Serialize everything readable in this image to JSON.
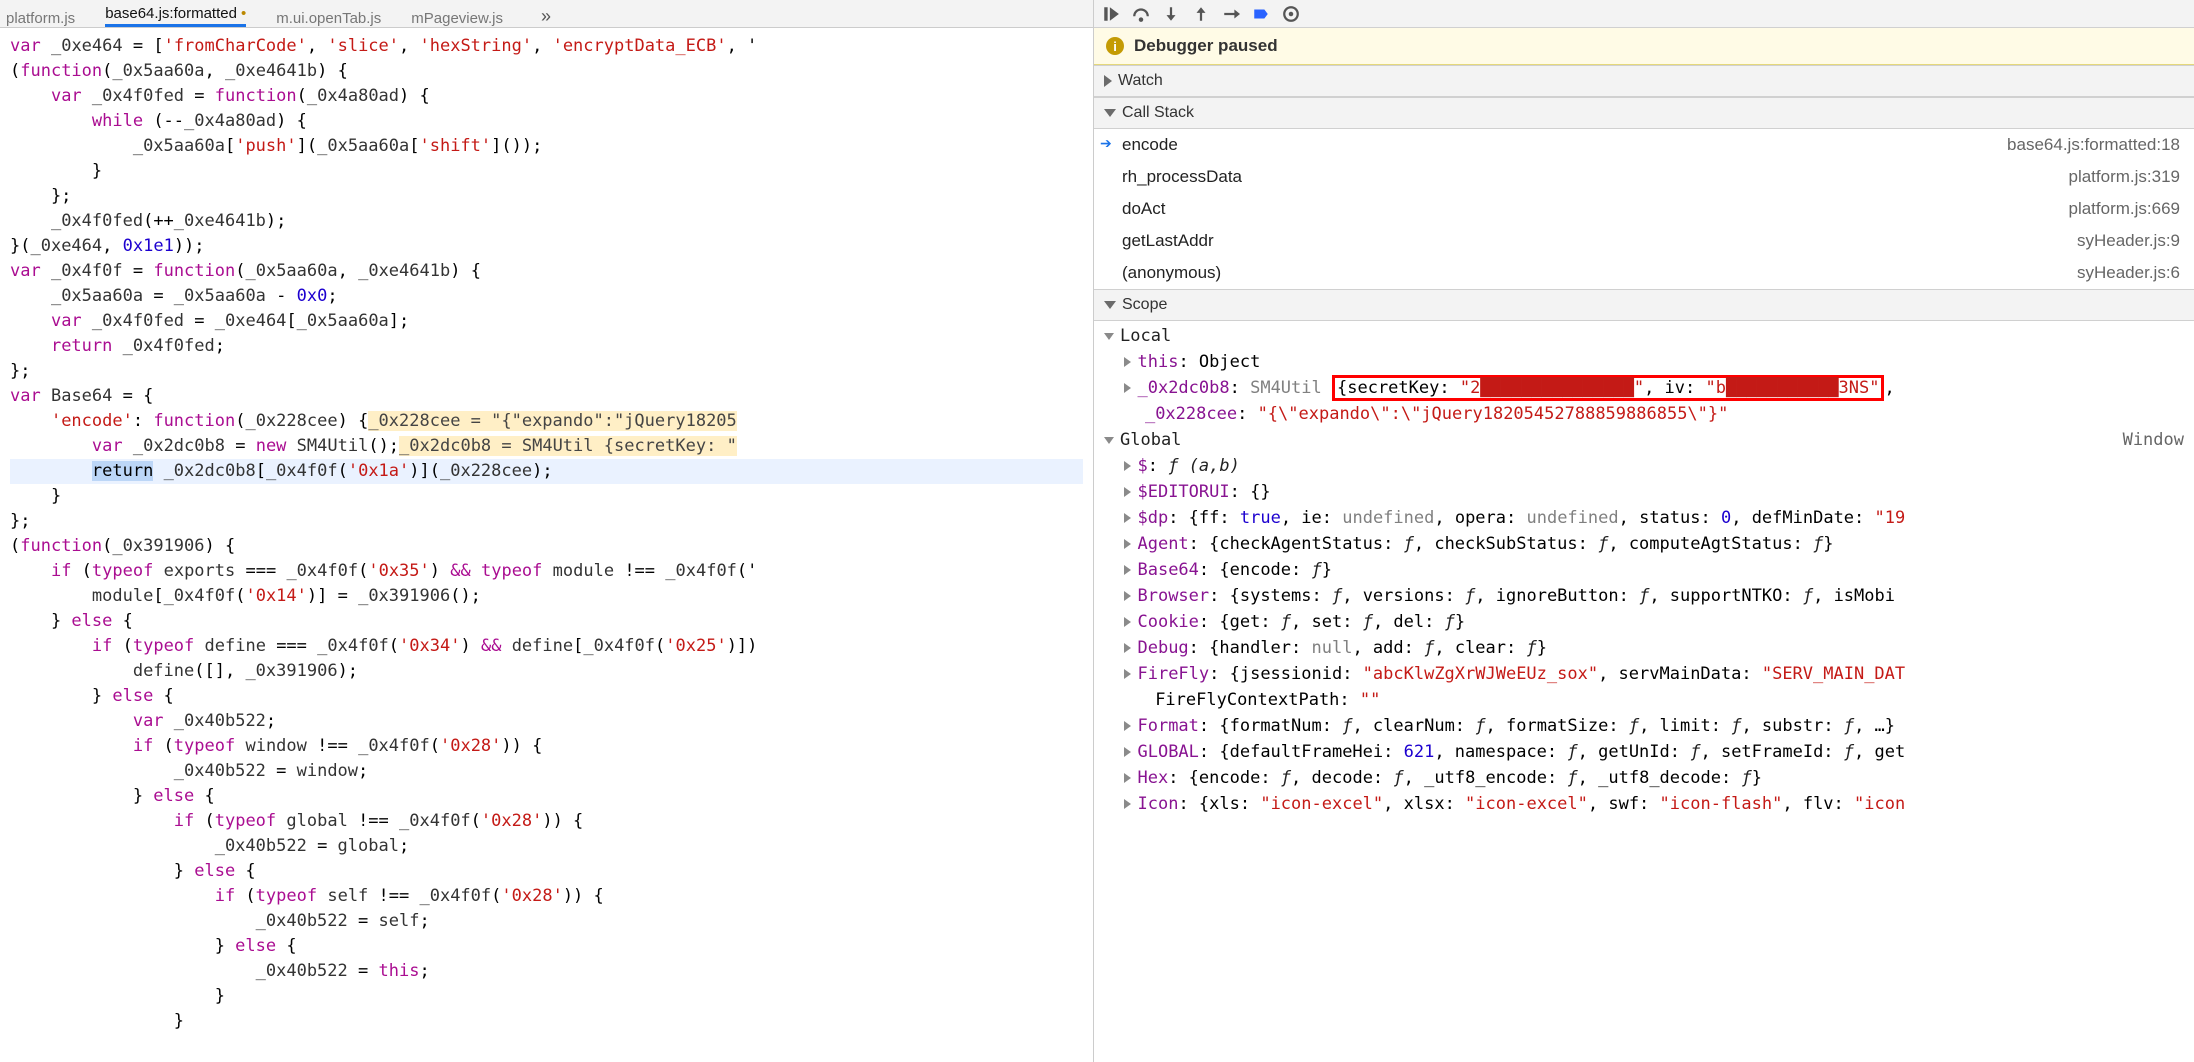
{
  "tabs": [
    {
      "label": "platform.js",
      "active": false,
      "dirty": false
    },
    {
      "label": "base64.js:formatted",
      "active": true,
      "dirty": true
    },
    {
      "label": "m.ui.openTab.js",
      "active": false,
      "dirty": false
    },
    {
      "label": "mPageview.js",
      "active": false,
      "dirty": false
    }
  ],
  "debugger_banner": "Debugger paused",
  "panels": {
    "watch": "Watch",
    "callstack": "Call Stack",
    "scope": "Scope"
  },
  "call_stack": [
    {
      "fn": "encode",
      "loc": "base64.js:formatted:18",
      "current": true
    },
    {
      "fn": "rh_processData",
      "loc": "platform.js:319",
      "current": false
    },
    {
      "fn": "doAct",
      "loc": "platform.js:669",
      "current": false
    },
    {
      "fn": "getLastAddr",
      "loc": "syHeader.js:9",
      "current": false
    },
    {
      "fn": "(anonymous)",
      "loc": "syHeader.js:6",
      "current": false
    }
  ],
  "scope_local_header": "Local",
  "scope_global_header": "Global",
  "scope_global_type": "Window",
  "local_vars": {
    "this_label": "this",
    "this_type": "Object",
    "v1_name": "_0x2dc0b8",
    "v1_type": "SM4Util",
    "v1_obj_prefix": "{secretKey: ",
    "v1_secret": "\"2███████████████\"",
    "v1_mid": ", iv: ",
    "v1_iv": "\"b███████████3NS\"",
    "v1_suffix": ",",
    "v2_name": "_0x228cee",
    "v2_val": "\"{\\\"expando\\\":\\\"jQuery18205452788859886855\\\"}\""
  },
  "globals": [
    {
      "k": "$",
      "rest": ": ",
      "f": "ƒ (a,b)"
    },
    {
      "k": "$EDITORUI",
      "rest": ": {}"
    },
    {
      "k": "$dp",
      "rest": ": {ff: ",
      "parts": [
        {
          "t": "n",
          "v": "true"
        },
        {
          "t": "p",
          "v": ", ie: "
        },
        {
          "t": "g",
          "v": "undefined"
        },
        {
          "t": "p",
          "v": ", opera: "
        },
        {
          "t": "g",
          "v": "undefined"
        },
        {
          "t": "p",
          "v": ", status: "
        },
        {
          "t": "n",
          "v": "0"
        },
        {
          "t": "p",
          "v": ", defMinDate: "
        },
        {
          "t": "s",
          "v": "\"19"
        }
      ]
    },
    {
      "k": "Agent",
      "rest": ": {checkAgentStatus: ",
      "parts": [
        {
          "t": "f",
          "v": "ƒ"
        },
        {
          "t": "p",
          "v": ", checkSubStatus: "
        },
        {
          "t": "f",
          "v": "ƒ"
        },
        {
          "t": "p",
          "v": ", computeAgtStatus: "
        },
        {
          "t": "f",
          "v": "ƒ"
        },
        {
          "t": "p",
          "v": "}"
        }
      ]
    },
    {
      "k": "Base64",
      "rest": ": {encode: ",
      "parts": [
        {
          "t": "f",
          "v": "ƒ"
        },
        {
          "t": "p",
          "v": "}"
        }
      ]
    },
    {
      "k": "Browser",
      "rest": ": {systems: ",
      "parts": [
        {
          "t": "f",
          "v": "ƒ"
        },
        {
          "t": "p",
          "v": ", versions: "
        },
        {
          "t": "f",
          "v": "ƒ"
        },
        {
          "t": "p",
          "v": ", ignoreButton: "
        },
        {
          "t": "f",
          "v": "ƒ"
        },
        {
          "t": "p",
          "v": ", supportNTKO: "
        },
        {
          "t": "f",
          "v": "ƒ"
        },
        {
          "t": "p",
          "v": ", isMobi"
        }
      ]
    },
    {
      "k": "Cookie",
      "rest": ": {get: ",
      "parts": [
        {
          "t": "f",
          "v": "ƒ"
        },
        {
          "t": "p",
          "v": ", set: "
        },
        {
          "t": "f",
          "v": "ƒ"
        },
        {
          "t": "p",
          "v": ", del: "
        },
        {
          "t": "f",
          "v": "ƒ"
        },
        {
          "t": "p",
          "v": "}"
        }
      ]
    },
    {
      "k": "Debug",
      "rest": ": {handler: ",
      "parts": [
        {
          "t": "g",
          "v": "null"
        },
        {
          "t": "p",
          "v": ", add: "
        },
        {
          "t": "f",
          "v": "ƒ"
        },
        {
          "t": "p",
          "v": ", clear: "
        },
        {
          "t": "f",
          "v": "ƒ"
        },
        {
          "t": "p",
          "v": "}"
        }
      ]
    },
    {
      "k": "FireFly",
      "rest": ": {jsessionid: ",
      "parts": [
        {
          "t": "s",
          "v": "\"abcKlwZgXrWJWeEUz_sox\""
        },
        {
          "t": "p",
          "v": ", servMainData: "
        },
        {
          "t": "s",
          "v": "\"SERV_MAIN_DAT"
        }
      ]
    },
    {
      "k": "",
      "rest": "FireFlyContextPath: ",
      "parts": [
        {
          "t": "s",
          "v": "\"\""
        }
      ],
      "noarrow": true
    },
    {
      "k": "Format",
      "rest": ": {formatNum: ",
      "parts": [
        {
          "t": "f",
          "v": "ƒ"
        },
        {
          "t": "p",
          "v": ", clearNum: "
        },
        {
          "t": "f",
          "v": "ƒ"
        },
        {
          "t": "p",
          "v": ", formatSize: "
        },
        {
          "t": "f",
          "v": "ƒ"
        },
        {
          "t": "p",
          "v": ", limit: "
        },
        {
          "t": "f",
          "v": "ƒ"
        },
        {
          "t": "p",
          "v": ", substr: "
        },
        {
          "t": "f",
          "v": "ƒ"
        },
        {
          "t": "p",
          "v": ", …}"
        }
      ]
    },
    {
      "k": "GLOBAL",
      "rest": ": {defaultFrameHei: ",
      "parts": [
        {
          "t": "n",
          "v": "621"
        },
        {
          "t": "p",
          "v": ", namespace: "
        },
        {
          "t": "f",
          "v": "ƒ"
        },
        {
          "t": "p",
          "v": ", getUnId: "
        },
        {
          "t": "f",
          "v": "ƒ"
        },
        {
          "t": "p",
          "v": ", setFrameId: "
        },
        {
          "t": "f",
          "v": "ƒ"
        },
        {
          "t": "p",
          "v": ", get"
        }
      ]
    },
    {
      "k": "Hex",
      "rest": ": {encode: ",
      "parts": [
        {
          "t": "f",
          "v": "ƒ"
        },
        {
          "t": "p",
          "v": ", decode: "
        },
        {
          "t": "f",
          "v": "ƒ"
        },
        {
          "t": "p",
          "v": ", _utf8_encode: "
        },
        {
          "t": "f",
          "v": "ƒ"
        },
        {
          "t": "p",
          "v": ", _utf8_decode: "
        },
        {
          "t": "f",
          "v": "ƒ"
        },
        {
          "t": "p",
          "v": "}"
        }
      ]
    },
    {
      "k": "Icon",
      "rest": ": {xls: ",
      "parts": [
        {
          "t": "s",
          "v": "\"icon-excel\""
        },
        {
          "t": "p",
          "v": ", xlsx: "
        },
        {
          "t": "s",
          "v": "\"icon-excel\""
        },
        {
          "t": "p",
          "v": ", swf: "
        },
        {
          "t": "s",
          "v": "\"icon-flash\""
        },
        {
          "t": "p",
          "v": ", flv: "
        },
        {
          "t": "s",
          "v": "\"icon"
        }
      ]
    }
  ],
  "code_hints": {
    "a": "_0x228cee = \"{\"expando\":\"jQuery18205",
    "b": "_0x2dc0b8 = SM4Util {secretKey: \""
  },
  "code_lines": [
    "var _0xe464 = ['fromCharCode', 'slice', 'hexString', 'encryptData_ECB', '",
    "(function(_0x5aa60a, _0xe4641b) {",
    "    var _0x4f0fed = function(_0x4a80ad) {",
    "        while (--_0x4a80ad) {",
    "            _0x5aa60a['push'](_0x5aa60a['shift']());",
    "        }",
    "    };",
    "    _0x4f0fed(++_0xe4641b);",
    "}(_0xe464, 0x1e1));",
    "var _0x4f0f = function(_0x5aa60a, _0xe4641b) {",
    "    _0x5aa60a = _0x5aa60a - 0x0;",
    "    var _0x4f0fed = _0xe464[_0x5aa60a];",
    "    return _0x4f0fed;",
    "};",
    "var Base64 = {",
    "    'encode': function(_0x228cee) {   HINT_A",
    "        var _0x2dc0b8 = new SM4Util();   HINT_B",
    "        return _0x2dc0b8[_0x4f0f('0x1a')](_0x228cee);",
    "    }",
    "};",
    "(function(_0x391906) {",
    "    if (typeof exports === _0x4f0f('0x35') && typeof module !== _0x4f0f('",
    "        module[_0x4f0f('0x14')] = _0x391906();",
    "    } else {",
    "        if (typeof define === _0x4f0f('0x34') && define[_0x4f0f('0x25')])",
    "            define([], _0x391906);",
    "        } else {",
    "            var _0x40b522;",
    "            if (typeof window !== _0x4f0f('0x28')) {",
    "                _0x40b522 = window;",
    "            } else {",
    "                if (typeof global !== _0x4f0f('0x28')) {",
    "                    _0x40b522 = global;",
    "                } else {",
    "                    if (typeof self !== _0x4f0f('0x28')) {",
    "                        _0x40b522 = self;",
    "                    } else {",
    "                        _0x40b522 = this;",
    "                    }",
    "                }"
  ]
}
